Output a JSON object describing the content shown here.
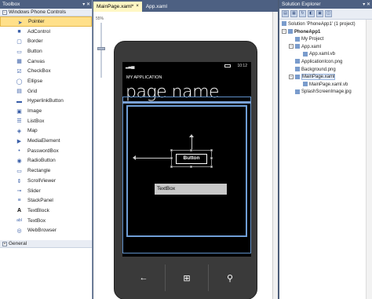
{
  "toolbox": {
    "title": "Toolbox",
    "group_label": "Windows Phone Controls",
    "items": [
      {
        "label": "Pointer",
        "icon": "pointer-icon"
      },
      {
        "label": "AdControl",
        "icon": "adcontrol-icon"
      },
      {
        "label": "Border",
        "icon": "border-icon"
      },
      {
        "label": "Button",
        "icon": "button-icon"
      },
      {
        "label": "Canvas",
        "icon": "canvas-icon"
      },
      {
        "label": "CheckBox",
        "icon": "checkbox-icon"
      },
      {
        "label": "Ellipse",
        "icon": "ellipse-icon"
      },
      {
        "label": "Grid",
        "icon": "grid-icon"
      },
      {
        "label": "HyperlinkButton",
        "icon": "hyperlink-icon"
      },
      {
        "label": "Image",
        "icon": "image-icon"
      },
      {
        "label": "ListBox",
        "icon": "listbox-icon"
      },
      {
        "label": "Map",
        "icon": "map-icon"
      },
      {
        "label": "MediaElement",
        "icon": "media-icon"
      },
      {
        "label": "PasswordBox",
        "icon": "password-icon"
      },
      {
        "label": "RadioButton",
        "icon": "radio-icon"
      },
      {
        "label": "Rectangle",
        "icon": "rectangle-icon"
      },
      {
        "label": "ScrollViewer",
        "icon": "scrollviewer-icon"
      },
      {
        "label": "Slider",
        "icon": "slider-icon"
      },
      {
        "label": "StackPanel",
        "icon": "stackpanel-icon"
      },
      {
        "label": "TextBlock",
        "icon": "textblock-icon"
      },
      {
        "label": "TextBox",
        "icon": "textbox-icon"
      },
      {
        "label": "WebBrowser",
        "icon": "webbrowser-icon"
      }
    ],
    "general_label": "General"
  },
  "tabs": [
    {
      "label": "MainPage.xaml*",
      "close": "×"
    },
    {
      "label": "App.xaml"
    }
  ],
  "zoom_label": "55%",
  "phone": {
    "time": "10:12",
    "app_title": "MY APPLICATION",
    "page_title": "page name",
    "button_label": "Button",
    "textbox_label": "TextBox"
  },
  "solution_explorer": {
    "title": "Solution Explorer",
    "items": [
      {
        "label": "Solution 'PhoneApp1' (1 project)",
        "level": 0
      },
      {
        "label": "PhoneApp1",
        "level": 0,
        "bold": true
      },
      {
        "label": "My Project",
        "level": 1
      },
      {
        "label": "App.xaml",
        "level": 1
      },
      {
        "label": "App.xaml.vb",
        "level": 2
      },
      {
        "label": "ApplicationIcon.png",
        "level": 1
      },
      {
        "label": "Background.png",
        "level": 1
      },
      {
        "label": "MainPage.xaml",
        "level": 1
      },
      {
        "label": "MainPage.xaml.vb",
        "level": 2
      },
      {
        "label": "SplashScreenImage.jpg",
        "level": 1
      }
    ]
  },
  "colors": {
    "title_bar": "#4d6082",
    "selection": "#ffe08a",
    "phone_accent": "#6f9ed6"
  }
}
